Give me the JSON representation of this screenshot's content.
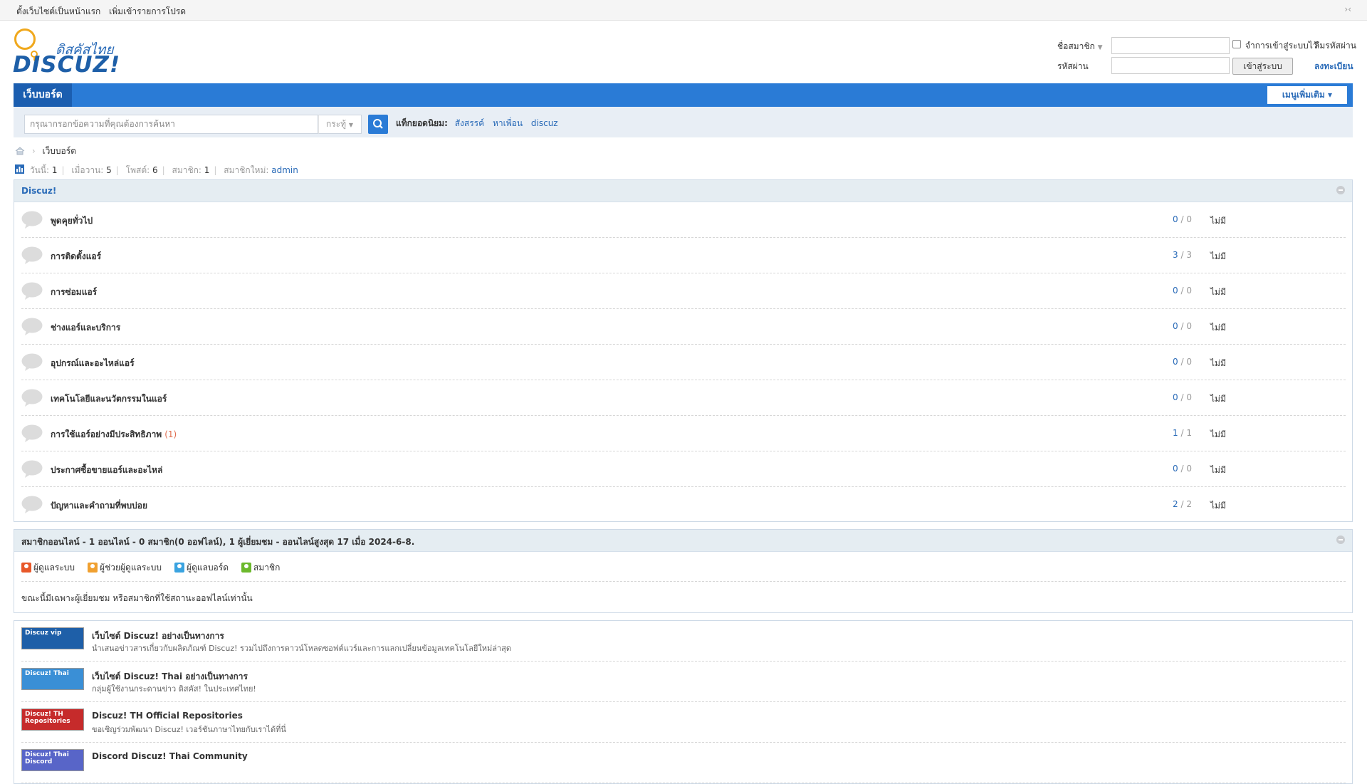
{
  "topbar": {
    "links": [
      "ตั้งเว็บไซต์เป็นหน้าแรก",
      "เพิ่มเข้ารายการโปรด"
    ],
    "collapse": "›‹"
  },
  "logo": {
    "thai": "ดิสคัสไทย",
    "main": "DISCUZ!"
  },
  "login": {
    "username_label": "ชื่อสมาชิก",
    "password_label": "รหัสผ่าน",
    "remember_label": "จำการเข้าสู่ระบบไว้",
    "forgot_link": "ลืมรหัสผ่าน",
    "register_link": "ลงทะเบียน",
    "login_button": "เข้าสู่ระบบ",
    "username_value": "",
    "password_value": ""
  },
  "nav": {
    "home": "เว็บบอร์ด",
    "more": "เมนูเพิ่มเติม ▾"
  },
  "search": {
    "placeholder": "กรุณากรอกข้อความที่คุณต้องการค้นหา",
    "type": "กระทู้",
    "hot_label": "แท็กยอดนิยม:",
    "hot_tags": [
      "สังสรรค์",
      "หาเพื่อน",
      "discuz"
    ]
  },
  "breadcrumb": {
    "current": "เว็บบอร์ด"
  },
  "stats": {
    "today_label": "วันนี้:",
    "today": "1",
    "yesterday_label": "เมื่อวาน:",
    "yesterday": "5",
    "posts_label": "โพสต์:",
    "posts": "6",
    "members_label": "สมาชิก:",
    "members": "1",
    "newest_label": "สมาชิกใหม่:",
    "newest": "admin"
  },
  "forum": {
    "category": "Discuz!",
    "rows": [
      {
        "name": "พูดคุยทั่วไป",
        "new": "",
        "threads": "0",
        "posts": "0",
        "last": "ไม่มี"
      },
      {
        "name": "การติดตั้งแอร์",
        "new": "",
        "threads": "3",
        "posts": "3",
        "last": "ไม่มี"
      },
      {
        "name": "การซ่อมแอร์",
        "new": "",
        "threads": "0",
        "posts": "0",
        "last": "ไม่มี"
      },
      {
        "name": "ช่างแอร์และบริการ",
        "new": "",
        "threads": "0",
        "posts": "0",
        "last": "ไม่มี"
      },
      {
        "name": "อุปกรณ์และอะไหล่แอร์",
        "new": "",
        "threads": "0",
        "posts": "0",
        "last": "ไม่มี"
      },
      {
        "name": "เทคโนโลยีและนวัตกรรมในแอร์",
        "new": "",
        "threads": "0",
        "posts": "0",
        "last": "ไม่มี"
      },
      {
        "name": "การใช้แอร์อย่างมีประสิทธิภาพ",
        "new": "(1)",
        "threads": "1",
        "posts": "1",
        "last": "ไม่มี"
      },
      {
        "name": "ประกาศซื้อขายแอร์และอะไหล่",
        "new": "",
        "threads": "0",
        "posts": "0",
        "last": "ไม่มี"
      },
      {
        "name": "ปัญหาและคำถามที่พบบ่อย",
        "new": "",
        "threads": "2",
        "posts": "2",
        "last": "ไม่มี"
      }
    ]
  },
  "online": {
    "title": "สมาชิกออนไลน์ - 1 ออนไลน์ - 0 สมาชิก(0 ออฟไลน์), 1 ผู้เยี่ยมชม - ออนไลน์สูงสุด 17 เมื่อ 2024-6-8.",
    "legend": [
      {
        "label": "ผู้ดูแลระบบ",
        "color": "#e8582a"
      },
      {
        "label": "ผู้ช่วยผู้ดูแลระบบ",
        "color": "#f0a030"
      },
      {
        "label": "ผู้ดูแลบอร์ด",
        "color": "#3aa3e0"
      },
      {
        "label": "สมาชิก",
        "color": "#6cb92d"
      }
    ],
    "note": "ขณะนี้มีเฉพาะผู้เยี่ยมชม หรือสมาชิกที่ใช้สถานะออฟไลน์เท่านั้น"
  },
  "links": [
    {
      "banner": "Discuz vip",
      "bg": "#1e5fa8",
      "title": "เว็บไซต์ Discuz! อย่างเป็นทางการ",
      "desc": "นำเสนอข่าวสารเกี่ยวกับผลิตภัณฑ์ Discuz! รวมไปถึงการดาวน์โหลดซอฟต์แวร์และการแลกเปลี่ยนข้อมูลเทคโนโลยีใหม่ล่าสุด"
    },
    {
      "banner": "Discuz! Thai",
      "bg": "#3a8fd6",
      "title": "เว็บไซต์ Discuz! Thai อย่างเป็นทางการ",
      "desc": "กลุ่มผู้ใช้งานกระดานข่าว ดิสคัส! ในประเทศไทย!"
    },
    {
      "banner": "Discuz! TH Repositories",
      "bg": "#c62b2b",
      "title": "Discuz! TH Official Repositories",
      "desc": "ขอเชิญร่วมพัฒนา Discuz! เวอร์ชันภาษาไทยกับเราได้ที่นี่"
    },
    {
      "banner": "Discuz! Thai Discord",
      "bg": "#5865c8",
      "title": "Discord Discuz! Thai Community",
      "desc": ""
    }
  ]
}
